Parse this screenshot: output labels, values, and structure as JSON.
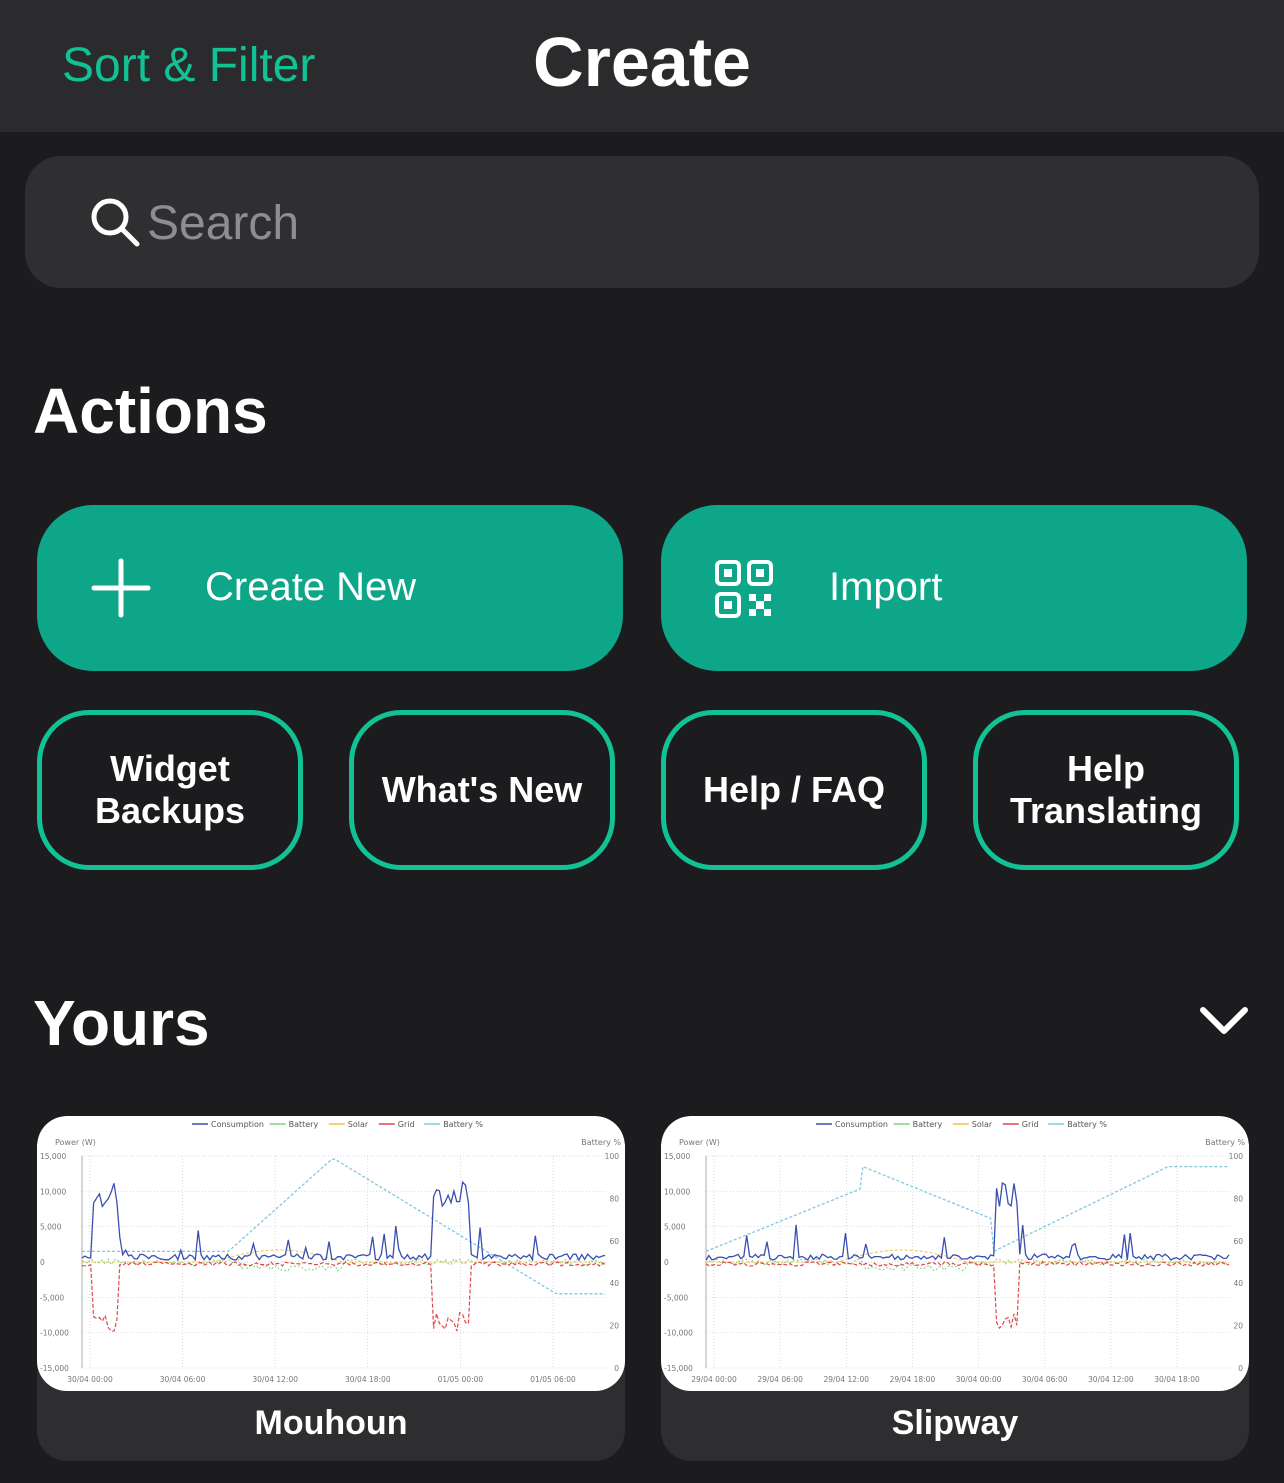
{
  "nav": {
    "left_label": "Sort & Filter",
    "title": "Create"
  },
  "search": {
    "placeholder": "Search"
  },
  "actions": {
    "heading": "Actions",
    "create_new": "Create New",
    "import": "Import",
    "widget_backups": "Widget\nBackups",
    "whats_new": "What's New",
    "help_faq": "Help / FAQ",
    "help_translating": "Help\nTranslating"
  },
  "yours": {
    "heading": "Yours",
    "widgets": [
      {
        "name": "Mouhoun",
        "chart": {
          "legend": [
            "Consumption",
            "Battery",
            "Solar",
            "Grid",
            "Battery %"
          ],
          "y_left_label": "Power (W)",
          "y_right_label": "Battery %",
          "y_left_ticks": [
            "15,000",
            "10,000",
            "5,000",
            "0",
            "-5,000",
            "-10,000",
            "-15,000"
          ],
          "y_right_ticks": [
            "100",
            "80",
            "60",
            "40",
            "20",
            "0"
          ],
          "x_ticks": [
            "30/04 00:00",
            "30/04 06:00",
            "30/04 12:00",
            "30/04 18:00",
            "01/05 00:00",
            "01/05 06:00"
          ]
        }
      },
      {
        "name": "Slipway",
        "chart": {
          "legend": [
            "Consumption",
            "Battery",
            "Solar",
            "Grid",
            "Battery %"
          ],
          "y_left_label": "Power (W)",
          "y_right_label": "Battery %",
          "y_left_ticks": [
            "15,000",
            "10,000",
            "5,000",
            "0",
            "-5,000",
            "-10,000",
            "-15,000"
          ],
          "y_right_ticks": [
            "100",
            "80",
            "60",
            "40",
            "20",
            "0"
          ],
          "x_ticks": [
            "29/04 00:00",
            "29/04 06:00",
            "29/04 12:00",
            "29/04 18:00",
            "30/04 00:00",
            "30/04 06:00",
            "30/04 12:00",
            "30/04 18:00"
          ]
        }
      }
    ]
  },
  "colors": {
    "accent": "#12c294",
    "button_fill": "#0ea688",
    "background": "#1c1c1e",
    "consumption": "#3b4fb0",
    "battery": "#7ed07a",
    "solar": "#f2c14e",
    "grid": "#e04848",
    "battery_pct": "#7fc8e0"
  }
}
